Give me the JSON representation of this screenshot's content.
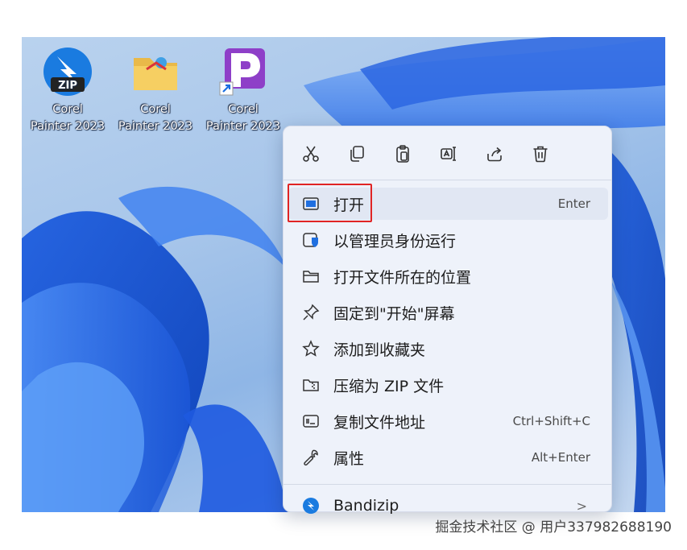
{
  "desktop": {
    "icons": [
      {
        "line1": "Corel",
        "line2": "Painter 2023",
        "icon": "zip-archive-icon"
      },
      {
        "line1": "Corel",
        "line2": "Painter 2023",
        "icon": "folder-icon"
      },
      {
        "line1": "Corel",
        "line2": "Painter 2023",
        "icon": "painter-shortcut-icon"
      }
    ]
  },
  "context_menu": {
    "toolbar": [
      {
        "name": "cut-icon"
      },
      {
        "name": "copy-icon"
      },
      {
        "name": "paste-icon"
      },
      {
        "name": "rename-icon"
      },
      {
        "name": "share-icon"
      },
      {
        "name": "delete-icon"
      }
    ],
    "items": [
      {
        "label": "打开",
        "shortcut": "Enter",
        "icon": "open-window-icon"
      },
      {
        "label": "以管理员身份运行",
        "shortcut": "",
        "icon": "admin-shield-icon"
      },
      {
        "label": "打开文件所在的位置",
        "shortcut": "",
        "icon": "folder-outline-icon"
      },
      {
        "label": "固定到\"开始\"屏幕",
        "shortcut": "",
        "icon": "pin-icon"
      },
      {
        "label": "添加到收藏夹",
        "shortcut": "",
        "icon": "star-icon"
      },
      {
        "label": "压缩为 ZIP 文件",
        "shortcut": "",
        "icon": "zip-folder-icon"
      },
      {
        "label": "复制文件地址",
        "shortcut": "Ctrl+Shift+C",
        "icon": "copy-path-icon"
      },
      {
        "label": "属性",
        "shortcut": "Alt+Enter",
        "icon": "wrench-icon"
      },
      {
        "label": "Bandizip",
        "shortcut": "",
        "icon": "bandizip-icon"
      }
    ],
    "submenu_indicator": ">"
  },
  "footer": {
    "credit": "掘金技术社区 @ 用户337982688190"
  },
  "colors": {
    "highlight_border": "#e02424",
    "menu_background": "#eef2fa",
    "hover_background": "#e1e7f3"
  }
}
